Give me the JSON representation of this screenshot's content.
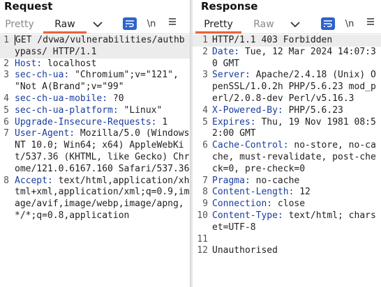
{
  "request": {
    "title": "Request",
    "tabs": [
      "Pretty",
      "Raw"
    ],
    "lines": [
      {
        "n": "1",
        "key": "",
        "text": "GET /dvwa/vulnerabilities/authbypass/ HTTP/1.1"
      },
      {
        "n": "2",
        "key": "Host:",
        "text": " localhost"
      },
      {
        "n": "3",
        "key": "sec-ch-ua:",
        "text": " \"Chromium\";v=\"121\", \"Not A(Brand\";v=\"99\""
      },
      {
        "n": "4",
        "key": "sec-ch-ua-mobile:",
        "text": " ?0"
      },
      {
        "n": "5",
        "key": "sec-ch-ua-platform:",
        "text": " \"Linux\""
      },
      {
        "n": "6",
        "key": "Upgrade-Insecure-Requests:",
        "text": " 1"
      },
      {
        "n": "7",
        "key": "User-Agent:",
        "text": " Mozilla/5.0 (Windows NT 10.0; Win64; x64) AppleWebKit/537.36 (KHTML, like Gecko) Chrome/121.0.6167.160 Safari/537.36"
      },
      {
        "n": "8",
        "key": "Accept:",
        "text": " text/html,application/xhtml+xml,application/xml;q=0.9,image/avif,image/webp,image/apng,*/*;q=0.8,application"
      }
    ]
  },
  "response": {
    "title": "Response",
    "tabs": [
      "Pretty",
      "Raw"
    ],
    "lines": [
      {
        "n": "1",
        "key": "",
        "text": "HTTP/1.1 403 Forbidden"
      },
      {
        "n": "2",
        "key": "Date:",
        "text": " Tue, 12 Mar 2024 14:07:30 GMT"
      },
      {
        "n": "3",
        "key": "Server:",
        "text": " Apache/2.4.18 (Unix) OpenSSL/1.0.2h PHP/5.6.23 mod_perl/2.0.8-dev Perl/v5.16.3"
      },
      {
        "n": "4",
        "key": "X-Powered-By:",
        "text": " PHP/5.6.23"
      },
      {
        "n": "5",
        "key": "Expires:",
        "text": " Thu, 19 Nov 1981 08:52:00 GMT"
      },
      {
        "n": "6",
        "key": "Cache-Control:",
        "text": " no-store, no-cache, must-revalidate, post-check=0, pre-check=0"
      },
      {
        "n": "7",
        "key": "Pragma:",
        "text": " no-cache"
      },
      {
        "n": "8",
        "key": "Content-Length:",
        "text": " 12"
      },
      {
        "n": "9",
        "key": "Connection:",
        "text": " close"
      },
      {
        "n": "10",
        "key": "Content-Type:",
        "text": " text/html; charset=UTF-8"
      },
      {
        "n": "11",
        "key": "",
        "text": ""
      },
      {
        "n": "12",
        "key": "",
        "text": "Unauthorised"
      }
    ]
  },
  "toolbar": {
    "newline_label": "\\n",
    "icons": [
      "chevron-down-icon",
      "text-wrap-icon",
      "newline-icon",
      "hamburger-menu-icon"
    ]
  },
  "colors": {
    "accent": "#e8643c",
    "header_key": "#1a3d9e",
    "button_blue": "#2e63c9"
  }
}
